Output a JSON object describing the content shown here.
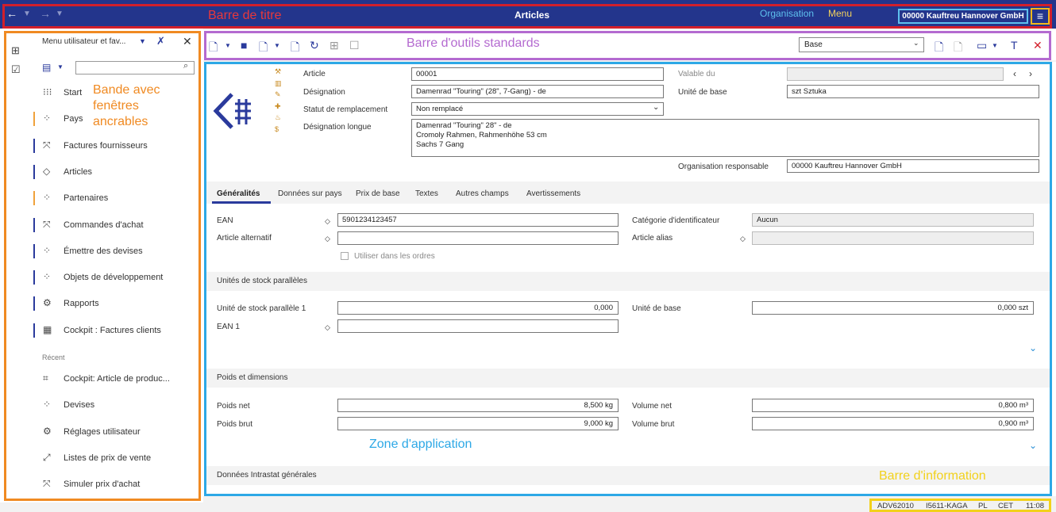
{
  "titlebar": {
    "title": "Articles",
    "annot_title": "Barre de titre",
    "annot_org": "Organisation",
    "annot_menu": "Menu",
    "org": "00000  Kauftreu Hannover GmbH",
    "back": "←",
    "forward": "→",
    "menu_glyph": "≡"
  },
  "sidebar": {
    "title": "Menu utilisateur et fav...",
    "annot": [
      "Bande avec",
      "fenêtres",
      "ancrables"
    ],
    "items": [
      {
        "label": "Start",
        "icon": "grid-icon",
        "color": ""
      },
      {
        "label": "Pays",
        "icon": "circles-icon",
        "color": "#f0a23c"
      },
      {
        "label": "Factures fournisseurs",
        "icon": "arrows-in-icon",
        "color": "#2a3a9c"
      },
      {
        "label": "Articles",
        "icon": "diamond-icon",
        "color": "#2a3a9c"
      },
      {
        "label": "Partenaires",
        "icon": "circles-icon",
        "color": "#f0a23c"
      },
      {
        "label": "Commandes d'achat",
        "icon": "arrows-in-icon",
        "color": "#2a3a9c"
      },
      {
        "label": "Émettre des devises",
        "icon": "circles-icon",
        "color": "#2a3a9c"
      },
      {
        "label": "Objets de développement",
        "icon": "circles-outline-icon",
        "color": "#2a3a9c"
      },
      {
        "label": "Rapports",
        "icon": "gear-icon",
        "color": "#2a3a9c"
      },
      {
        "label": "Cockpit : Factures clients",
        "icon": "cockpit-icon",
        "color": "#2a3a9c"
      }
    ],
    "recent_label": "Récent",
    "recent": [
      {
        "label": "Cockpit: Article de produc...",
        "icon": "chart-icon"
      },
      {
        "label": "Devises",
        "icon": "circles-icon"
      },
      {
        "label": "Réglages utilisateur",
        "icon": "user-gear-icon"
      },
      {
        "label": "Listes de prix de vente",
        "icon": "arrows-out-icon"
      },
      {
        "label": "Simuler prix d'achat",
        "icon": "arrows-in-icon"
      }
    ]
  },
  "toolbar": {
    "annot": "Barre d'outils standards",
    "view": "Base"
  },
  "form": {
    "article_label": "Article",
    "article": "00001",
    "valid_label": "Valable du",
    "valid": "",
    "designation_label": "Désignation",
    "designation": "Damenrad \"Touring\" (28\", 7-Gang) - de",
    "unit_label": "Unité de base",
    "unit": "szt Sztuka",
    "status_label": "Statut de remplacement",
    "status": "Non remplacé",
    "long_label": "Désignation longue",
    "long_lines": [
      "Damenrad \"Touring\" 28\" - de",
      "Cromoly Rahmen, Rahmenhöhe 53 cm",
      "Sachs 7 Gang"
    ],
    "org_label": "Organisation responsable",
    "org": "00000  Kauftreu Hannover GmbH"
  },
  "tabs": [
    "Généralités",
    "Données sur pays",
    "Prix de base",
    "Textes",
    "Autres champs",
    "Avertissements"
  ],
  "general": {
    "ean_label": "EAN",
    "ean": "5901234123457",
    "cat_label": "Catégorie d'identificateur",
    "cat": "Aucun",
    "alt_label": "Article alternatif",
    "alt": "",
    "alias_label": "Article alias",
    "alias": "",
    "use_orders": "Utiliser dans les ordres"
  },
  "parallel": {
    "title": "Unités de stock parallèles",
    "unit1_label": "Unité de stock parallèle 1",
    "unit1": "0,000",
    "base_label": "Unité de base",
    "base": "0,000 szt",
    "ean1_label": "EAN 1",
    "ean1": ""
  },
  "weights": {
    "title": "Poids et dimensions",
    "net_label": "Poids net",
    "net": "8,500 kg",
    "gross_label": "Poids brut",
    "gross": "9,000 kg",
    "vol_net_label": "Volume net",
    "vol_net": "0,800 m³",
    "vol_gross_label": "Volume brut",
    "vol_gross": "0,900 m³"
  },
  "intrastat": {
    "title": "Données Intrastat générales"
  },
  "annots": {
    "app": "Zone d'application",
    "info": "Barre d'information"
  },
  "infobar": [
    "ADV62010",
    "I5611-KAGA",
    "PL",
    "CET",
    "11:08"
  ]
}
